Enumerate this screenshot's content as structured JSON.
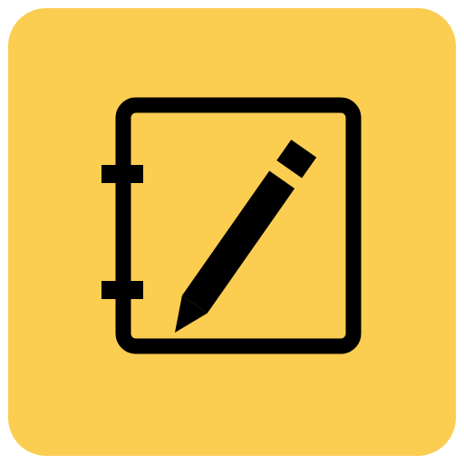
{
  "app_icon": {
    "icon": "notebook-pencil-icon",
    "background_color": "#FBCD51",
    "glyph_color": "#000000"
  }
}
